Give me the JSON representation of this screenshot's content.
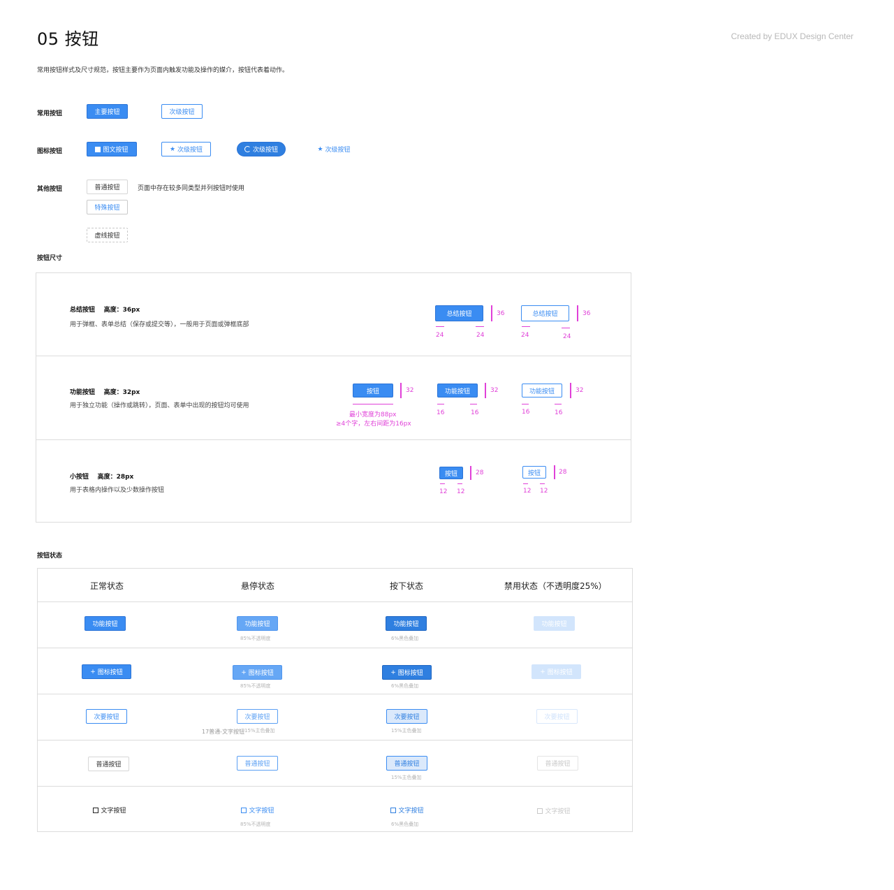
{
  "header": {
    "title": "05 按钮",
    "credit": "Created by EDUX Design Center",
    "description": "常用按钮样式及尺寸规范，按钮主要作为页面内触发功能及操作的媒介，按钮代表着动作。"
  },
  "common": {
    "label": "常用按钮",
    "primary": "主要按钮",
    "secondary": "次级按钮"
  },
  "icon_buttons": {
    "label": "图标按钮",
    "b1": "图文按钮",
    "b2": "次级按钮",
    "b3": "次级按钮",
    "b4": "次级按钮"
  },
  "other": {
    "label": "其他按钮",
    "normal": "普通按钮",
    "note": "页面中存在较多同类型并列按钮时使用",
    "special": "特殊按钮",
    "dashed": "虚线按钮"
  },
  "sizes": {
    "label": "按钮尺寸",
    "summary": {
      "title": "总结按钮",
      "height": "高度：36px",
      "desc": "用于弹框、表单总结（保存或提交等），一般用于页面或弹框底部",
      "btn": "总结按钮",
      "h": "36",
      "pad_l": "24",
      "pad_r": "24"
    },
    "function": {
      "title": "功能按钮",
      "height": "高度：32px",
      "desc": "用于独立功能（操作或跳转），页面、表单中出现的按钮均可使用",
      "btn_min": "按钮",
      "btn": "功能按钮",
      "h": "32",
      "pad_l": "16",
      "pad_r": "16",
      "min_note_1": "最小宽度为88px",
      "min_note_2": "≥4个字，左右间距为16px"
    },
    "small": {
      "title": "小按钮",
      "height": "高度：28px",
      "desc": "用于表格内操作以及少数操作按钮",
      "btn": "按钮",
      "h": "28",
      "pad_l": "12",
      "pad_r": "12"
    }
  },
  "states": {
    "label": "按钮状态",
    "headers": [
      "正常状态",
      "悬停状态",
      "按下状态",
      "禁用状态（不透明度25%）"
    ],
    "func": "功能按钮",
    "icon": "图标按钮",
    "secondary": "次要按钮",
    "normal": "普通按钮",
    "text": "文字按钮",
    "note_85": "85%不透明度",
    "note_6": "6%黑色叠加",
    "note_15": "15%主色叠加",
    "overlap_note": "17普通-文字按钮",
    "overlap_note_2": "15%主色叠加"
  },
  "colors": {
    "primary": "#3a8cf2",
    "annotation": "#e040d8"
  },
  "icons": [
    "image-icon",
    "star-icon",
    "loading-icon",
    "plus-icon",
    "checkbox-icon"
  ]
}
